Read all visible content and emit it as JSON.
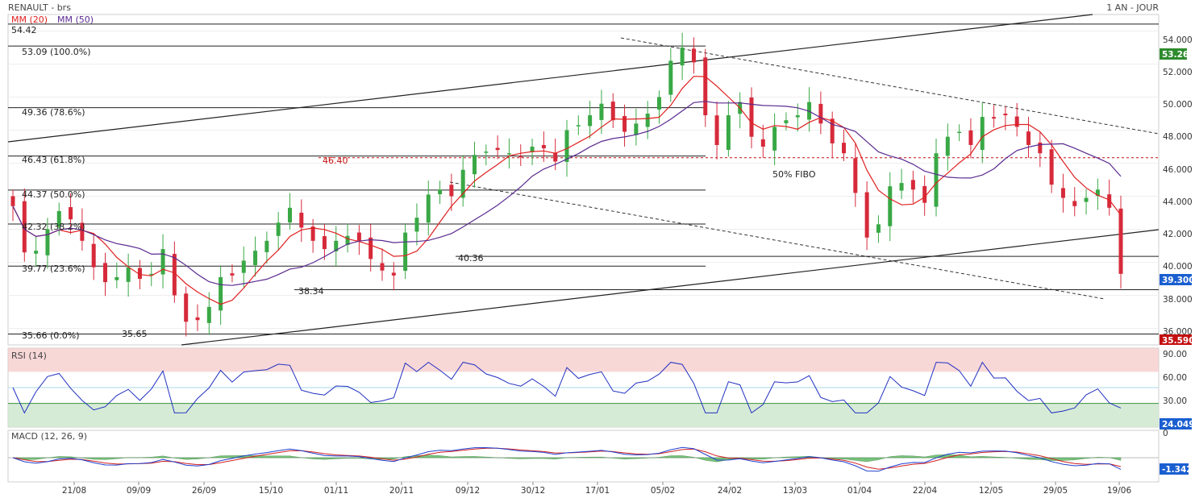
{
  "header": {
    "symbol_line": "RENAULT - brs",
    "period": "1 AN - JOUR",
    "ma20_label": "MM (20)",
    "ma50_label": "MM (50)",
    "ma20_color": "#e02020",
    "ma50_color": "#5a2a90"
  },
  "price_axis": {
    "ticks": [
      "54.000",
      "52.000",
      "50.000",
      "48.000",
      "46.000",
      "44.000",
      "42.000",
      "40.000",
      "38.000",
      "36.000"
    ],
    "last_close_tag": "53.26",
    "last_close_tag_color": "#2e8b2e",
    "current_tag": "39.300",
    "current_tag_color": "#1a5fd0",
    "low_tag": "35.590",
    "low_tag_color": "#c41010"
  },
  "levels": {
    "top_label": "54.42",
    "fib_100": "53.09  (100.0%)",
    "fib_786": "49.36  (78.6%)",
    "fib_618": "46.43  (61.8%)",
    "fib_500": "44.37  (50.0%)",
    "fib_382": "42.32  (38.2%)",
    "fib_236": "39.77  (23.6%)",
    "fib_0": "35.66  (0.0%)",
    "low_point": "35.65",
    "support_3834": "38.34",
    "support_4036": "40.36",
    "resistance_4640": "46.40",
    "fibo_note": "50% FIBO"
  },
  "rsi": {
    "label": "RSI (14)",
    "ticks": [
      "90.00",
      "60.00",
      "30.00"
    ],
    "current_tag": "24.049",
    "current_tag_color": "#1a5fd0",
    "overbought_color": "#f6c9c9",
    "oversold_color": "#cfe8cf"
  },
  "macd": {
    "label": "MACD (12, 26, 9)",
    "ticks": [
      "0"
    ],
    "current_tag": "-1.342",
    "current_tag_color": "#1a5fd0",
    "macd_color": "#2040d0",
    "signal_color": "#d02020",
    "hist_color": "#4caf50"
  },
  "chart_data": {
    "type": "candlestick",
    "title": "RENAULT - brs",
    "x_ticks": [
      "21/08",
      "09/09",
      "26/09",
      "15/10",
      "01/11",
      "20/11",
      "09/12",
      "30/12",
      "17/01",
      "05/02",
      "24/02",
      "13/03",
      "01/04",
      "22/04",
      "12/05",
      "29/05",
      "19/06"
    ],
    "ylim": [
      35.0,
      55.0
    ],
    "series": [
      {
        "name": "MM (20)",
        "color": "#e02020"
      },
      {
        "name": "MM (50)",
        "color": "#5a2a90"
      }
    ],
    "key_levels": [
      54.42,
      53.09,
      49.36,
      46.43,
      46.4,
      44.37,
      42.32,
      40.36,
      39.77,
      38.34,
      35.66,
      35.65
    ],
    "close_path": [
      43.4,
      40.6,
      40.7,
      42.0,
      43.1,
      42.6,
      41.3,
      39.7,
      38.8,
      39.1,
      39.7,
      39.0,
      39.3,
      40.8,
      38.0,
      36.4,
      36.5,
      37.3,
      39.1,
      39.2,
      40.1,
      40.7,
      41.3,
      42.4,
      43.3,
      42.1,
      41.3,
      40.8,
      41.3,
      41.6,
      41.3,
      40.2,
      39.5,
      39.2,
      41.8,
      42.7,
      44.1,
      44.4,
      44.0,
      45.6,
      46.5,
      46.7,
      46.8,
      46.6,
      46.4,
      47.0,
      46.9,
      46.1,
      48.0,
      48.3,
      48.9,
      49.6,
      48.6,
      47.9,
      48.4,
      49.0,
      50.0,
      52.2,
      53.0,
      52.1,
      48.9,
      47.1,
      48.9,
      49.7,
      47.6,
      47.0,
      48.2,
      48.6,
      48.9,
      49.7,
      48.4,
      47.2,
      46.6,
      44.2,
      41.5,
      42.3,
      44.6,
      44.8,
      44.4,
      43.6,
      46.6,
      47.6,
      47.9,
      47.1,
      48.8,
      48.7,
      48.9,
      48.2,
      47.1,
      46.6,
      44.7,
      43.9,
      43.4,
      43.9,
      44.4,
      43.3,
      39.3
    ]
  }
}
